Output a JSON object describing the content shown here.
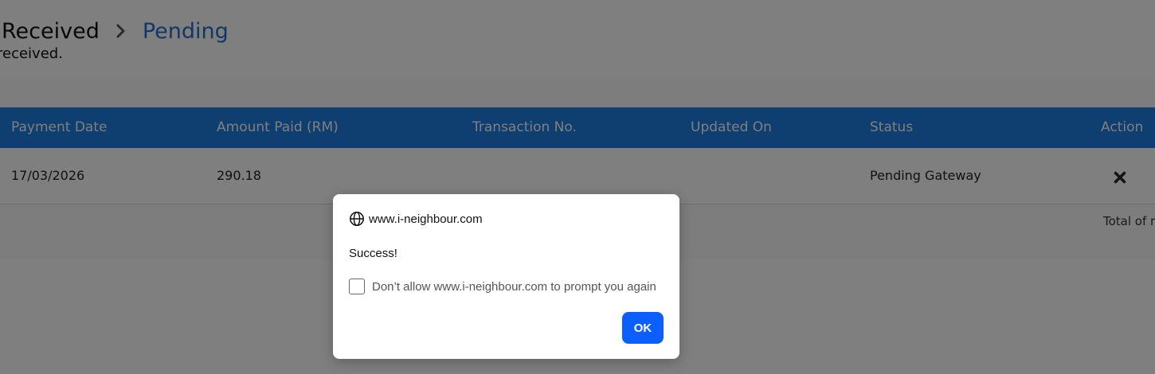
{
  "breadcrumb": {
    "previous": "Received",
    "current": "Pending"
  },
  "subtitle": "received.",
  "table": {
    "headers": [
      "Payment Date",
      "Amount Paid (RM)",
      "Transaction No.",
      "Updated On",
      "Status",
      "Action"
    ],
    "rows": [
      {
        "payment_date": "17/03/2026",
        "amount_paid": "290.18",
        "transaction_no": "",
        "updated_on": "",
        "status": "Pending Gateway",
        "action_icon": "close-x-icon"
      }
    ],
    "total_text": "Total of r"
  },
  "dialog": {
    "origin": "www.i-neighbour.com",
    "origin_icon": "globe-icon",
    "message": "Success!",
    "suppress_label": "Don’t allow www.i-neighbour.com to prompt you again",
    "suppress_checked": false,
    "ok_label": "OK"
  },
  "colors": {
    "header_bg": "#1f7de0",
    "breadcrumb_current": "#1f6fd1",
    "ok_button": "#0b5fff"
  }
}
